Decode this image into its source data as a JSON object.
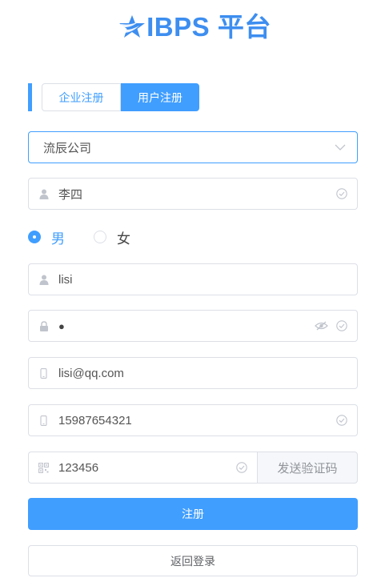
{
  "logo": {
    "text": "IBPS 平台"
  },
  "tabs": [
    {
      "label": "企业注册",
      "active": false
    },
    {
      "label": "用户注册",
      "active": true
    }
  ],
  "form": {
    "company": {
      "value": "流辰公司"
    },
    "full_name": {
      "value": "李四"
    },
    "gender": {
      "options": [
        {
          "label": "男",
          "checked": true
        },
        {
          "label": "女",
          "checked": false
        }
      ]
    },
    "username": {
      "value": "lisi"
    },
    "password": {
      "value": "●"
    },
    "email": {
      "value": "lisi@qq.com"
    },
    "phone": {
      "value": "15987654321"
    },
    "verify_code": {
      "value": "123456",
      "send_label": "发送验证码"
    }
  },
  "actions": {
    "register_label": "注册",
    "back_label": "返回登录"
  },
  "colors": {
    "primary": "#409eff",
    "border": "#dcdfe6",
    "icon": "#c0c4cc",
    "logo": "#3d8ef0"
  },
  "icons": {
    "logo": "star-logo-icon",
    "select": "chevron-down-icon",
    "user": "user-icon",
    "lock": "lock-icon",
    "eye": "eye-slash-icon",
    "valid": "circle-check-icon",
    "phone": "mobile-icon",
    "code": "qrcode-icon"
  }
}
